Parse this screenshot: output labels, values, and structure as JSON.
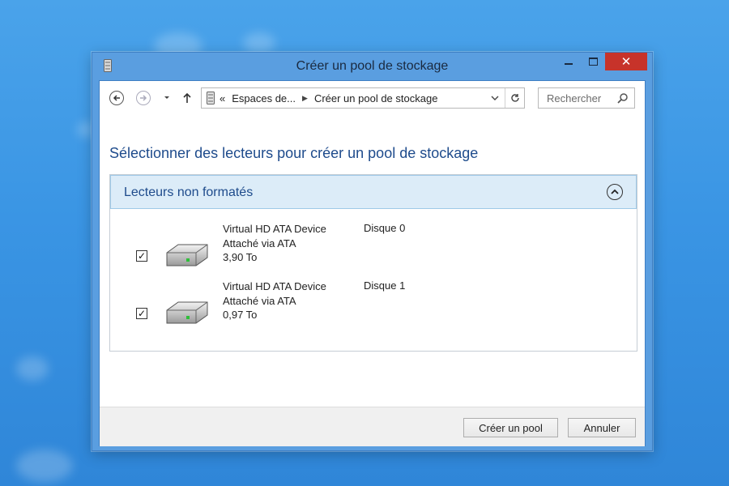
{
  "window": {
    "title": "Créer un pool de stockage",
    "controls": {
      "minimize": "–",
      "maximize": "□",
      "close": "✕"
    }
  },
  "toolbar": {
    "breadcrumb": {
      "prefix": "«",
      "parent": "Espaces de...",
      "current": "Créer un pool de stockage"
    },
    "search": {
      "placeholder": "Rechercher"
    }
  },
  "main": {
    "heading": "Sélectionner des lecteurs pour créer un pool de stockage",
    "section": {
      "title": "Lecteurs non formatés",
      "drives": [
        {
          "name": "Virtual HD ATA Device",
          "connection": "Attaché via ATA",
          "size": "3,90 To",
          "disk": "Disque 0",
          "checked": true
        },
        {
          "name": "Virtual HD ATA Device",
          "connection": "Attaché via ATA",
          "size": "0,97 To",
          "disk": "Disque 1",
          "checked": true
        }
      ]
    }
  },
  "footer": {
    "create_label": "Créer un pool",
    "cancel_label": "Annuler"
  },
  "colors": {
    "accent": "#1e4b8c",
    "section_header_bg": "#dcecf8",
    "close_button": "#c7332a"
  }
}
